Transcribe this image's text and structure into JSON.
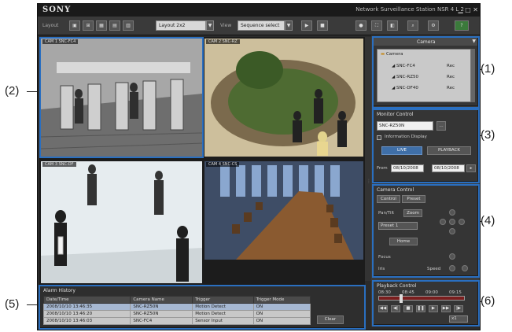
{
  "callouts": [
    "(1)",
    "(2)",
    "(3)",
    "(4)",
    "(5)",
    "(6)"
  ],
  "titlebar": {
    "brand": "SONY",
    "product": "Network Surveillance Station NSR 4 L 2"
  },
  "toolbar": {
    "layout_label": "Layout",
    "layout_dropdown": "Layout 2x2",
    "view_label": "View",
    "view_dropdown": "Sequence select"
  },
  "monitor": {
    "tiles": [
      {
        "caption": "CAM 1  SNC-FC4",
        "scene": "turnstiles"
      },
      {
        "caption": "CAM 2  SNC-RZ",
        "scene": "lobby"
      },
      {
        "caption": "CAM 3  SNC-DF",
        "scene": "walkers"
      },
      {
        "caption": "CAM 4  SNC-CS",
        "scene": "conference"
      }
    ]
  },
  "camera_list": {
    "title": "Camera",
    "root": "Camera",
    "items": [
      {
        "name": "SNC-FC4",
        "status": "Rec"
      },
      {
        "name": "SNC-RZ50",
        "status": "Rec"
      },
      {
        "name": "SNC-DF40",
        "status": "Rec"
      }
    ]
  },
  "monitor_control": {
    "title": "Monitor Control",
    "camera_field": "SNC-RZ50N",
    "checkbox_label": "Information Display",
    "live_button": "LIVE",
    "playback_button": "PLAYBACK",
    "from_label": "From",
    "from_value": "08/10/2008",
    "to_value": "08/10/2008"
  },
  "camera_control": {
    "title": "Camera Control",
    "tabs": [
      "Control",
      "Preset"
    ],
    "rows": [
      "Pan/Tilt",
      "Zoom",
      "Focus",
      "Iris"
    ],
    "dropdown": "Preset 1",
    "home_button": "Home",
    "speed_label": "Speed"
  },
  "alarm_history": {
    "title": "Alarm History",
    "columns": [
      "Date/Time",
      "Camera Name",
      "Trigger",
      "Trigger Mode"
    ],
    "rows": [
      [
        "2008/10/10 13:46:35",
        "SNC-RZ50N",
        "Motion Detect",
        "ON"
      ],
      [
        "2008/10/10 13:46:20",
        "SNC-RZ50N",
        "Motion Detect",
        "ON"
      ],
      [
        "2008/10/10 13:46:03",
        "SNC-FC4",
        "Sensor Input",
        "ON"
      ]
    ],
    "clear_button": "Clear"
  },
  "playback_control": {
    "title": "Playback Control",
    "times": [
      "08:30",
      "08:45",
      "09:00",
      "09:15"
    ],
    "speed_value": "x1"
  },
  "colors": {
    "highlight": "#2a6fc0",
    "accent_blue": "#3f6fa8",
    "seek_bar": "#7a1e1e"
  },
  "icons": [
    "close-icon",
    "minimize-icon",
    "maximize-icon",
    "gear-icon",
    "grid-layout-icon",
    "fullscreen-icon",
    "play-icon",
    "pause-icon",
    "stop-icon",
    "rewind-icon",
    "fast-forward-icon",
    "arrow-up-icon",
    "arrow-down-icon",
    "arrow-left-icon",
    "arrow-right-icon"
  ]
}
